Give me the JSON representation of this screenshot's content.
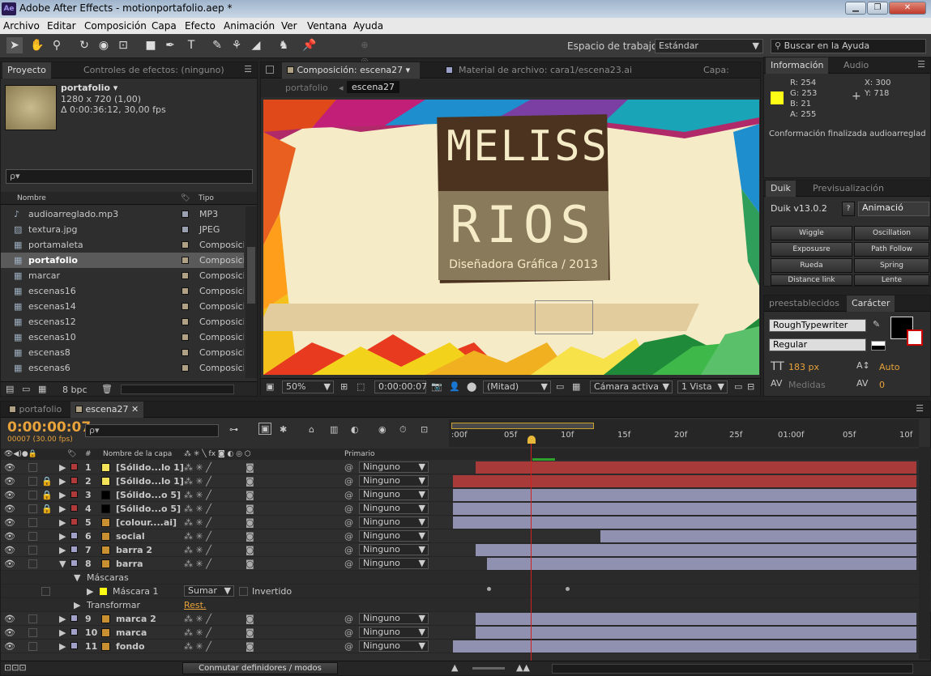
{
  "titlebar": {
    "title": "Adobe After Effects - motionportafolio.aep *",
    "icon": "Ae"
  },
  "menu": [
    "Archivo",
    "Editar",
    "Composición",
    "Capa",
    "Efecto",
    "Animación",
    "Ver",
    "Ventana",
    "Ayuda"
  ],
  "toolbar": {
    "workspace_label": "Espacio de trabajo:",
    "workspace_value": "Estándar",
    "help_placeholder": "Buscar en la Ayuda"
  },
  "project": {
    "tabs": [
      "Proyecto",
      "Controles de efectos: (ninguno)"
    ],
    "item_name": "portafolio ▾",
    "item_size": "1280 x 720 (1,00)",
    "item_duration": "Δ 0:00:36:12, 30,00 fps",
    "search_placeholder": "ρ▾",
    "col_name": "Nombre",
    "col_type": "Tipo",
    "items": [
      {
        "name": "audioarreglado.mp3",
        "type": "MP3",
        "color": "#9aa0b0"
      },
      {
        "name": "textura.jpg",
        "type": "JPEG",
        "color": "#9aa0b0"
      },
      {
        "name": "portamaleta",
        "type": "Composici",
        "color": "#b1a184"
      },
      {
        "name": "portafolio",
        "type": "Composici",
        "color": "#b1a184"
      },
      {
        "name": "marcar",
        "type": "Composici",
        "color": "#b1a184"
      },
      {
        "name": "escenas16",
        "type": "Composici",
        "color": "#b1a184"
      },
      {
        "name": "escenas14",
        "type": "Composici",
        "color": "#b1a184"
      },
      {
        "name": "escenas12",
        "type": "Composici",
        "color": "#b1a184"
      },
      {
        "name": "escenas10",
        "type": "Composici",
        "color": "#b1a184"
      },
      {
        "name": "escenas8",
        "type": "Composici",
        "color": "#b1a184"
      },
      {
        "name": "escenas6",
        "type": "Composici",
        "color": "#b1a184"
      }
    ],
    "bpc": "8 bpc"
  },
  "comp": {
    "tab": "Composición: escena27",
    "footage_tab": "Material de archivo: cara1/escena23.ai",
    "layer_tab": "Capa:",
    "breadcrumb": [
      "portafolio",
      "escena27"
    ],
    "logo_line1": "MELISSA",
    "logo_line2": "RIOS",
    "logo_sub": "Diseñadora Gráfica / 2013",
    "zoom": "50%",
    "timecode": "0:00:00:07",
    "resolution": "(Mitad)",
    "camera": "Cámara activa",
    "views": "1 Vista"
  },
  "info": {
    "tabs": [
      "Información",
      "Audio"
    ],
    "r": "R:  254",
    "g": "G:  253",
    "b": "B:  21",
    "a": "A:  255",
    "x": "X:  300",
    "y": "Y:  718",
    "swatch": "#fefd15",
    "status": "Conformación finalizada audioarreglad"
  },
  "duik": {
    "tabs": [
      "Duik",
      "Previsualización"
    ],
    "version": "Duik v13.0.2",
    "help": "?",
    "mode": "Animació",
    "buttons": [
      "Wiggle",
      "Oscillation",
      "Exposusre",
      "Path Follow",
      "Rueda",
      "Spring",
      "Distance link",
      "Lente"
    ]
  },
  "character": {
    "tabs": [
      "preestablecidos",
      "Carácter"
    ],
    "font": "RoughTypewriter",
    "style": "Regular",
    "size": "183 px",
    "leading": "Auto",
    "kerning": "Medidas",
    "tracking": "0"
  },
  "timeline": {
    "tabs": [
      "portafolio",
      "escena27"
    ],
    "timecode": "0:00:00:07",
    "fps": "00007 (30.00 fps)",
    "search_placeholder": "ρ▾",
    "col_name": "Nombre de la capa",
    "col_parent": "Primario",
    "ruler": [
      ":00f",
      "05f",
      "10f",
      "15f",
      "20f",
      "25f",
      "01:00f",
      "05f",
      "10f"
    ],
    "layers": [
      {
        "num": "1",
        "name": "[Sólido...lo 1]",
        "label": "#b03a3a",
        "swatch": "#f4e35a",
        "parent": "Ninguno"
      },
      {
        "num": "2",
        "name": "[Sólido...lo 1]",
        "label": "#b03a3a",
        "swatch": "#f4e35a",
        "parent": "Ninguno"
      },
      {
        "num": "3",
        "name": "[Sólido...o 5]",
        "label": "#b03a3a",
        "swatch": "#000000",
        "parent": "Ninguno"
      },
      {
        "num": "4",
        "name": "[Sólido...o 5]",
        "label": "#b03a3a",
        "swatch": "#000000",
        "parent": "Ninguno"
      },
      {
        "num": "5",
        "name": "[colour....ai]",
        "label": "#b03a3a",
        "swatch": "#c89030",
        "parent": "Ninguno"
      },
      {
        "num": "6",
        "name": "social",
        "label": "#a0a0c8",
        "swatch": "#c89030",
        "parent": "Ninguno"
      },
      {
        "num": "7",
        "name": "barra 2",
        "label": "#a0a0c8",
        "swatch": "#c89030",
        "parent": "Ninguno"
      },
      {
        "num": "8",
        "name": "barra",
        "label": "#a0a0c8",
        "swatch": "#c89030",
        "parent": "Ninguno"
      }
    ],
    "masks_label": "Máscaras",
    "mask_name": "Máscara 1",
    "mask_mode": "Sumar",
    "mask_inverted": "Invertido",
    "transform_label": "Transformar",
    "transform_reset": "Rest.",
    "layers2": [
      {
        "num": "9",
        "name": "marca 2",
        "label": "#a0a0c8",
        "swatch": "#c89030",
        "parent": "Ninguno"
      },
      {
        "num": "10",
        "name": "marca",
        "label": "#a0a0c8",
        "swatch": "#c89030",
        "parent": "Ninguno"
      },
      {
        "num": "11",
        "name": "fondo",
        "label": "#a0a0c8",
        "swatch": "#c89030",
        "parent": "Ninguno"
      }
    ],
    "toggle_label": "Conmutar definidores / modos"
  }
}
